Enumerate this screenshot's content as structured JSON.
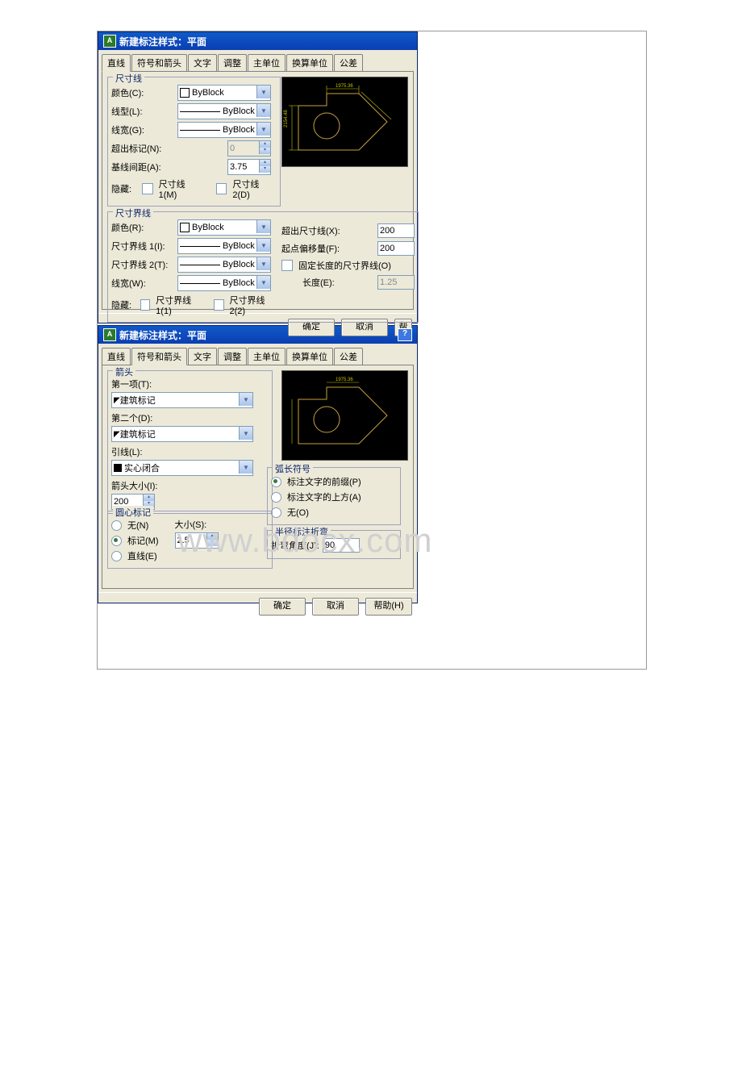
{
  "watermark": "www.bdocx.com",
  "dlg1": {
    "title": "新建标注样式：平面",
    "tabs": [
      "直线",
      "符号和箭头",
      "文字",
      "调整",
      "主单位",
      "换算单位",
      "公差"
    ],
    "active_tab": "直线",
    "dim_line": {
      "legend": "尺寸线",
      "color_lbl": "颜色(C):",
      "color_val": "ByBlock",
      "ltype_lbl": "线型(L):",
      "ltype_val": "ByBlock",
      "lweight_lbl": "线宽(G):",
      "lweight_val": "ByBlock",
      "extend_lbl": "超出标记(N):",
      "extend_val": "0",
      "baseline_lbl": "基线间距(A):",
      "baseline_val": "3.75",
      "hide_lbl": "隐藏:",
      "hide1": "尺寸线 1(M)",
      "hide2": "尺寸线 2(D)"
    },
    "ext_line": {
      "legend": "尺寸界线",
      "color_lbl": "颜色(R):",
      "color_val": "ByBlock",
      "ext1_lbl": "尺寸界线 1(I):",
      "ext1_val": "ByBlock",
      "ext2_lbl": "尺寸界线 2(T):",
      "ext2_val": "ByBlock",
      "lweight_lbl": "线宽(W):",
      "lweight_val": "ByBlock",
      "hide_lbl": "隐藏:",
      "hide1": "尺寸界线 1(1)",
      "hide2": "尺寸界线 2(2)",
      "beyond_lbl": "超出尺寸线(X):",
      "beyond_val": "200",
      "offset_lbl": "起点偏移量(F):",
      "offset_val": "200",
      "fixed_lbl": "固定长度的尺寸界线(O)",
      "len_lbl": "长度(E):",
      "len_val": "1.25"
    },
    "preview_dim": "1975.36",
    "buttons": {
      "ok": "确定",
      "cancel": "取消",
      "help": "帮"
    }
  },
  "dlg2": {
    "title": "新建标注样式：平面",
    "tabs": [
      "直线",
      "符号和箭头",
      "文字",
      "调整",
      "主单位",
      "换算单位",
      "公差"
    ],
    "active_tab": "符号和箭头",
    "arrow": {
      "legend": "箭头",
      "first_lbl": "第一项(T):",
      "first_val": "建筑标记",
      "second_lbl": "第二个(D):",
      "second_val": "建筑标记",
      "leader_lbl": "引线(L):",
      "leader_val": "实心闭合",
      "size_lbl": "箭头大小(I):",
      "size_val": "200"
    },
    "center": {
      "legend": "圆心标记",
      "none": "无(N)",
      "mark": "标记(M)",
      "line": "直线(E)",
      "size_lbl": "大小(S):",
      "size_val": "2.5"
    },
    "arc": {
      "legend": "弧长符号",
      "opt1": "标注文字的前缀(P)",
      "opt2": "标注文字的上方(A)",
      "opt3": "无(O)"
    },
    "radius": {
      "legend": "半径标注折弯",
      "angle_lbl": "折弯角度(J):",
      "angle_val": "90"
    },
    "preview_dim": "1975.36",
    "buttons": {
      "ok": "确定",
      "cancel": "取消",
      "help": "帮助(H)"
    }
  }
}
